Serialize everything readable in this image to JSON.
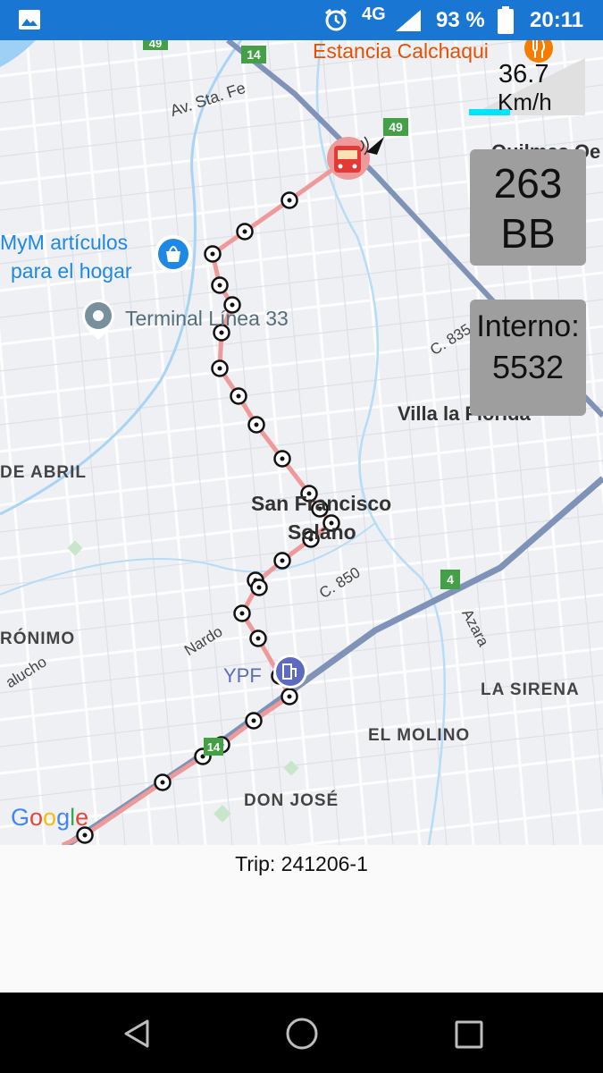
{
  "status_bar": {
    "network": "4G",
    "battery": "93 %",
    "time": "20:11",
    "color": "#1976d2"
  },
  "map": {
    "labels": {
      "estancia": "Estancia Calchaqui",
      "av_sta_fe": "Av. Sta. Fe",
      "mym": [
        "MyM artículos",
        "para el hogar"
      ],
      "terminal": "Terminal Línea 33",
      "quilmes": "Quilmes Oe",
      "c835": "C. 835",
      "villa_florida": "Villa la Florida",
      "de_abril": "DE ABRIL",
      "san_francisco": [
        "San Francisco",
        "Solano"
      ],
      "c850": "C. 850",
      "nardo": "Nardo",
      "azara": "Azara",
      "ronimo": "RÓNIMO",
      "ypf": "YPF",
      "la_sirena": "LA SIRENA",
      "el_molino": "EL MOLINO",
      "don_jose": "DON JOSÉ",
      "palucho": "alucho",
      "google": "Google"
    },
    "route_shields": [
      "49",
      "14",
      "49",
      "4",
      "14"
    ],
    "route_color": "#ef9a9a",
    "road_color": "#7f93b8"
  },
  "speed": {
    "value": "36.7",
    "unit": "Km/h",
    "level": 0.35
  },
  "line_panel": {
    "line1": "263",
    "line2": "BB"
  },
  "interno_panel": {
    "label": "Interno:",
    "value": "5532"
  },
  "trip": {
    "text": "Trip: 241206-1"
  },
  "nav": {
    "back": "back-icon",
    "home": "home-icon",
    "recents": "recents-icon"
  }
}
